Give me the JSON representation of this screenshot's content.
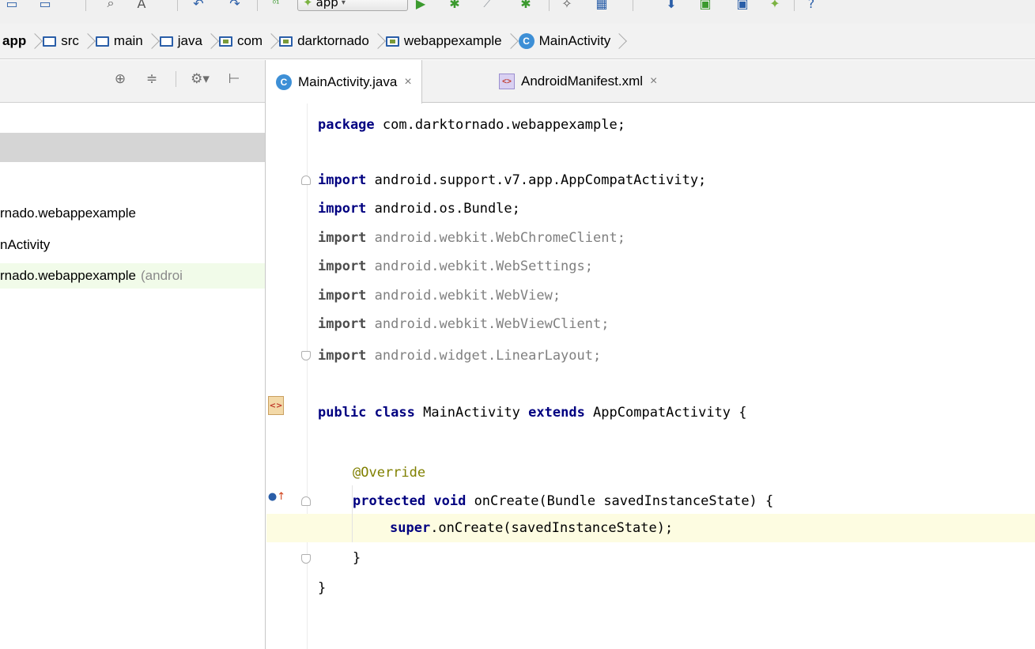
{
  "breadcrumb": [
    {
      "label": "app",
      "icon": "module-icon"
    },
    {
      "label": "src",
      "icon": "folder-icon"
    },
    {
      "label": "main",
      "icon": "folder-icon"
    },
    {
      "label": "java",
      "icon": "folder-icon"
    },
    {
      "label": "com",
      "icon": "package-icon"
    },
    {
      "label": "darktornado",
      "icon": "package-icon"
    },
    {
      "label": "webappexample",
      "icon": "package-icon"
    },
    {
      "label": "MainActivity",
      "icon": "class-icon"
    }
  ],
  "toolbar": {
    "run_config": "app",
    "icons": [
      "sync-icon",
      "structure-icon",
      "find-icon",
      "replace-icon",
      "undo-icon",
      "redo-icon",
      "build-icon",
      "run-icon",
      "debug-icon",
      "coverage-icon",
      "profile-icon",
      "attach-icon",
      "sdk-manager-icon",
      "avd-manager-icon",
      "device-monitor-icon",
      "android-icon",
      "help-icon"
    ]
  },
  "project_panel": {
    "header_icons": [
      "locate-icon",
      "collapse-icon",
      "settings-icon",
      "hide-icon"
    ],
    "tree": [
      {
        "label": "rnado.webappexample",
        "note": ""
      },
      {
        "label": "nActivity",
        "note": ""
      },
      {
        "label": "rnado.webappexample",
        "note": "(androi"
      }
    ]
  },
  "tabs": [
    {
      "label": "MainActivity.java",
      "icon": "class-icon",
      "close": "×",
      "active": true
    },
    {
      "label": "AndroidManifest.xml",
      "icon": "xml-icon",
      "close": "×",
      "active": false
    }
  ],
  "code": {
    "package_kw": "package",
    "package_name": " com.darktornado.webappexample;",
    "imports_used": [
      {
        "kw": "import",
        "path": " android.support.v7.app.AppCompatActivity;"
      },
      {
        "kw": "import",
        "path": " android.os.Bundle;"
      }
    ],
    "imports_unused": [
      {
        "kw": "import",
        "path": " android.webkit.WebChromeClient;"
      },
      {
        "kw": "import",
        "path": " android.webkit.WebSettings;"
      },
      {
        "kw": "import",
        "path": " android.webkit.WebView;"
      },
      {
        "kw": "import",
        "path": " android.webkit.WebViewClient;"
      },
      {
        "kw": "import",
        "path": " android.widget.LinearLayout;"
      }
    ],
    "class_line": {
      "kw1": "public",
      "kw2": "class",
      "name": " MainActivity ",
      "kw3": "extends",
      "rest": " AppCompatActivity {"
    },
    "annotation": "@Override",
    "method_line": {
      "kw1": "protected",
      "kw2": "void",
      "rest": " onCreate(Bundle savedInstanceState) {"
    },
    "super_line": {
      "kw": "super",
      "rest": ".onCreate(savedInstanceState);"
    },
    "close_method": "}",
    "close_class": "}"
  }
}
